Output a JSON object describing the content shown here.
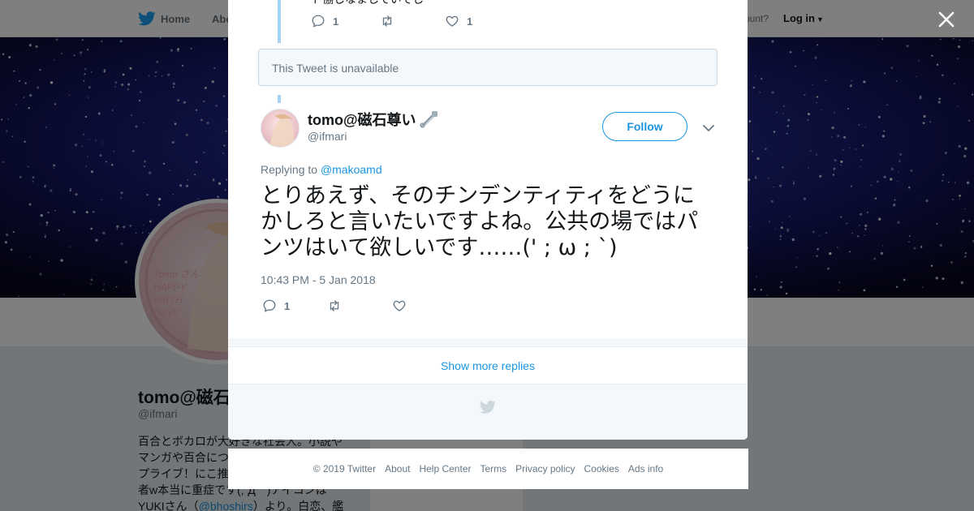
{
  "topnav": {
    "home_label": "Home",
    "about_label": "Abo",
    "account_prompt": "ccount?",
    "login_label": "Log in"
  },
  "profile": {
    "avatar_text": [
      "Tomo  さん",
      "HAPPY",
      "BIRTH",
      "DAY!!"
    ],
    "name": "tomo@磁石",
    "handle": "@ifmari",
    "bio_lines": [
      "百合とボカロが大好きな社会人。小説や",
      "マンガや百合につ",
      "プライブ！にこ推",
      "者w本当に重症です(;´Д｀)アイコンは"
    ],
    "bio_last_prefix": "YUKIさん（",
    "bio_mention": "@bhoshirs",
    "bio_last_suffix": "）より。白恋、艦こ"
  },
  "modal": {
    "prev_tweet": {
      "cut_text": "ト協しなましていでし",
      "reply_count": "1",
      "like_count": "1"
    },
    "unavailable_text": "This Tweet is unavailable",
    "tweet": {
      "author_name": "tomo@磁石尊い",
      "author_handle": "@ifmari",
      "follow_label": "Follow",
      "replying_prefix": "Replying to ",
      "replying_to": "@makoamd",
      "text": "とりあえず、そのチンデンティティをどうにかしろと言いたいですよね。公共の場ではパンツはいて欲しいです……(' ; ω ; `)",
      "timestamp": "10:43 PM - 5 Jan 2018",
      "reply_count": "1",
      "retweet_count": "",
      "like_count": ""
    },
    "show_more_label": "Show more replies"
  },
  "footer": {
    "links": [
      "© 2019 Twitter",
      "About",
      "Help Center",
      "Terms",
      "Privacy policy",
      "Cookies",
      "Ads info"
    ]
  },
  "icons": {
    "brand": "twitter-bird-icon",
    "close": "close-icon",
    "reply": "reply-icon",
    "retweet": "retweet-icon",
    "like": "heart-icon",
    "caret": "chevron-down-icon",
    "name_emoji": "safety-pin-icon"
  },
  "colors": {
    "twitter_blue": "#1b95e0",
    "brand_bird": "#1da1f2",
    "thread_line": "#a3d3f5",
    "muted_text": "#657786",
    "overlay": "rgba(0,0,0,0.5)"
  }
}
